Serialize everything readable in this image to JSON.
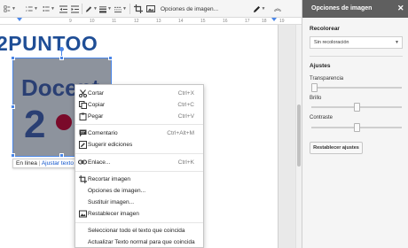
{
  "toolbar": {
    "image_options_label": "Opciones de imagen..."
  },
  "ruler": {
    "numbers": [
      "9",
      "10",
      "11",
      "12",
      "13",
      "14",
      "15",
      "16",
      "17",
      "18",
      "19"
    ]
  },
  "document": {
    "logo_text": "2PUNTOO",
    "image_text_word": "Docent",
    "image_text_number": "2",
    "inline_bar": {
      "inline_label": "En línea",
      "separator": "|",
      "wrap_link": "Ajustar texto"
    }
  },
  "context_menu": {
    "items": [
      {
        "label": "Cortar",
        "shortcut": "Ctrl+X",
        "icon": "scissors-icon"
      },
      {
        "label": "Copiar",
        "shortcut": "Ctrl+C",
        "icon": "copy-icon"
      },
      {
        "label": "Pegar",
        "shortcut": "Ctrl+V",
        "icon": "paste-icon"
      },
      {
        "label": "Comentario",
        "shortcut": "Ctrl+Alt+M",
        "icon": "comment-icon"
      },
      {
        "label": "Sugerir ediciones",
        "shortcut": "",
        "icon": "suggest-edit-icon"
      },
      {
        "label": "Enlace...",
        "shortcut": "Ctrl+K",
        "icon": "link-icon"
      },
      {
        "label": "Recortar imagen",
        "shortcut": "",
        "icon": "crop-icon"
      },
      {
        "label": "Opciones de imagen...",
        "shortcut": "",
        "icon": ""
      },
      {
        "label": "Sustituir imagen...",
        "shortcut": "",
        "icon": ""
      },
      {
        "label": "Restablecer imagen",
        "shortcut": "",
        "icon": "reset-image-icon"
      },
      {
        "label": "Seleccionar todo el texto que coincida",
        "shortcut": "",
        "icon": ""
      },
      {
        "label": "Actualizar Texto normal para que coincida",
        "shortcut": "",
        "icon": ""
      }
    ]
  },
  "panel": {
    "title": "Opciones de imagen",
    "close_glyph": "✕",
    "recolor_label": "Recolorear",
    "recolor_value": "Sin recoloración",
    "adjustments_label": "Ajustes",
    "transparency_label": "Transparencia",
    "transparency_value": 0,
    "brightness_label": "Brillo",
    "brightness_value": 0.5,
    "contrast_label": "Contraste",
    "contrast_value": 0.5,
    "reset_button": "Restablecer ajustes"
  },
  "colors": {
    "accent": "#4a86e8",
    "panel_header": "#5f5f5f",
    "logo": "#1f4e96"
  }
}
